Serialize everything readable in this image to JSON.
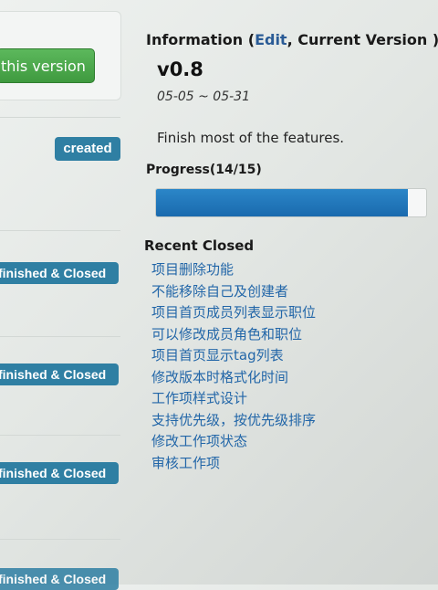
{
  "left": {
    "version_button": "this version",
    "created_badge": "created",
    "closed_badges": [
      "finished & Closed",
      "finished & Closed",
      "finished & Closed",
      "finished & Closed"
    ]
  },
  "info": {
    "heading_prefix": "Information (",
    "edit_link": "Edit",
    "heading_suffix": ", Current Version )",
    "version": "v0.8",
    "date_range": "05-05 ~ 05-31",
    "description": "Finish most of the features.",
    "progress_label": "Progress(14/15)",
    "progress_fraction": 0.933,
    "progress_color": "#1f74b8"
  },
  "recent": {
    "heading": "Recent Closed",
    "items": [
      "项目删除功能",
      "不能移除自己及创建者",
      "项目首页成员列表显示职位",
      "可以修改成员角色和职位",
      "项目首页显示tag列表",
      "修改版本时格式化时间",
      "工作项样式设计",
      "支持优先级，按优先级排序",
      "修改工作项状态",
      "审核工作项"
    ]
  }
}
